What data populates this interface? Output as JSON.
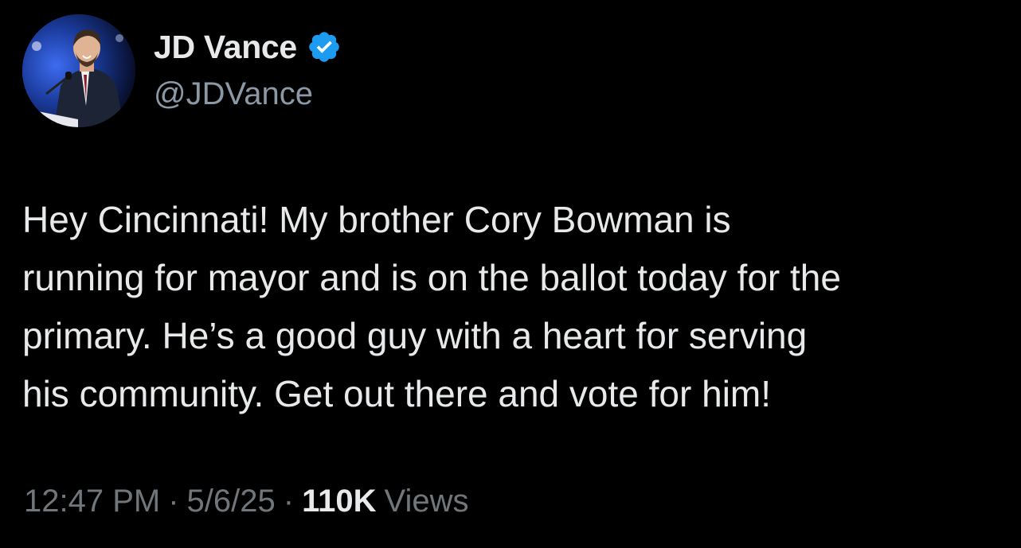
{
  "author": {
    "display_name": "JD Vance",
    "handle": "@JDVance",
    "verified": true,
    "verified_icon": "verified-badge-icon",
    "verified_color": "#1d9bf0"
  },
  "tweet": {
    "text": "Hey Cincinnati! My brother Cory Bowman is\nrunning for mayor and is on the ballot today for the\nprimary. He’s a good guy with a heart for serving\nhis community. Get out there and vote for him!"
  },
  "meta": {
    "time": "12:47 PM",
    "separator": "·",
    "date": "5/6/25",
    "views_count": "110K",
    "views_label": "Views"
  },
  "colors": {
    "background": "#000000",
    "primary_text": "#e7e9ea",
    "secondary_text": "#71767b"
  }
}
